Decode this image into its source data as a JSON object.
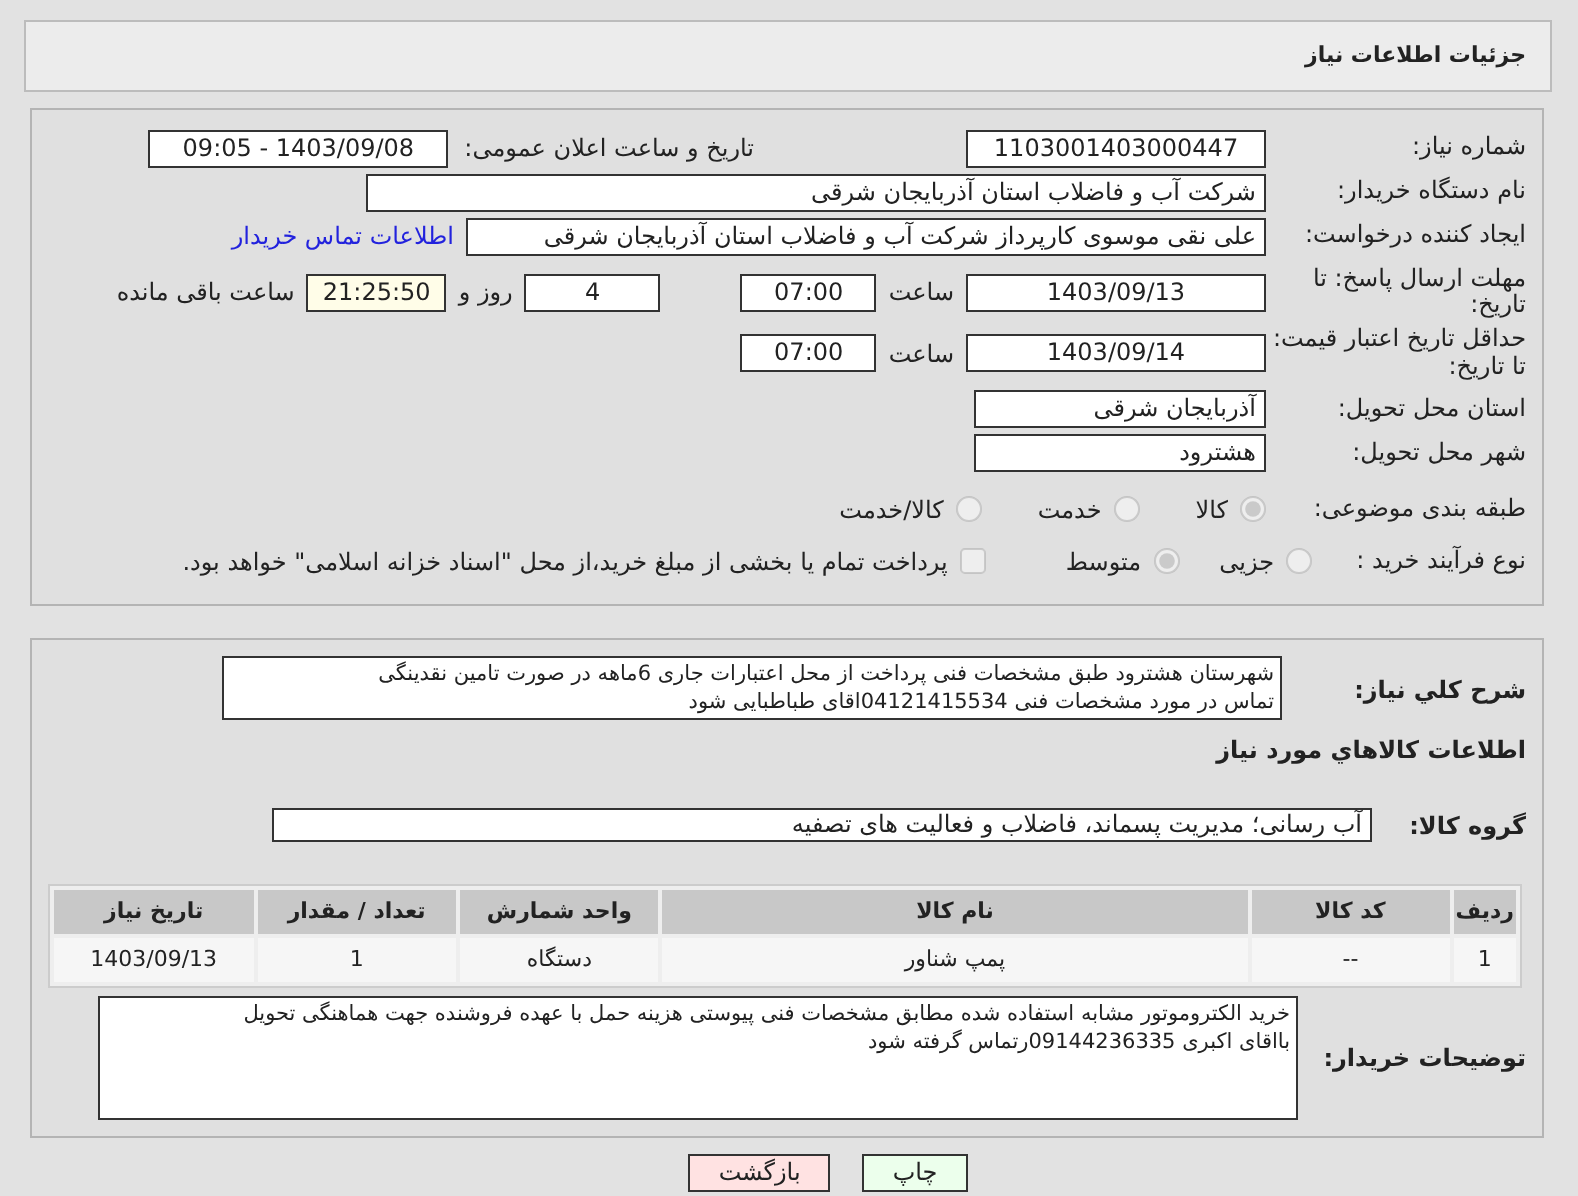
{
  "page_title": "جزئیات اطلاعات نیاز",
  "need_number": {
    "label": "شماره نیاز:",
    "value": "1103001403000447"
  },
  "announce": {
    "label": "تاریخ و ساعت اعلان عمومی:",
    "value": "1403/09/08 - 09:05"
  },
  "buyer": {
    "label": "نام دستگاه خریدار:",
    "value": "شرکت آب و فاضلاب استان آذربایجان شرقی"
  },
  "creator": {
    "label": "ایجاد کننده درخواست:",
    "value": "علی نقی موسوی کارپرداز شرکت آب و فاضلاب استان آذربایجان شرقی",
    "link": "اطلاعات تماس خریدار"
  },
  "reply_deadline": {
    "label": "مهلت ارسال پاسخ: تا تاریخ:",
    "date": "1403/09/13",
    "time_label": "ساعت",
    "time": "07:00",
    "days": "4",
    "days_label": "روز و",
    "remaining": "21:25:50",
    "remaining_label": "ساعت باقی مانده"
  },
  "price_validity": {
    "label": "حداقل تاریخ اعتبار قیمت: تا تاریخ:",
    "date": "1403/09/14",
    "time_label": "ساعت",
    "time": "07:00"
  },
  "province": {
    "label": "استان محل تحویل:",
    "value": "آذربایجان شرقی"
  },
  "city": {
    "label": "شهر محل تحویل:",
    "value": "هشترود"
  },
  "category": {
    "label": "طبقه بندی موضوعی:",
    "options": [
      {
        "label": "کالا",
        "selected": true
      },
      {
        "label": "خدمت",
        "selected": false
      },
      {
        "label": "کالا/خدمت",
        "selected": false
      }
    ]
  },
  "process": {
    "label": "نوع فرآیند خرید :",
    "options": [
      {
        "label": "جزیی",
        "selected": false
      },
      {
        "label": "متوسط",
        "selected": true
      }
    ],
    "checkbox": {
      "label": "پرداخت تمام یا بخشی از مبلغ خرید،از محل \"اسناد خزانه اسلامی\" خواهد بود.",
      "checked": false
    }
  },
  "description": {
    "label": "شرح کلي نياز:",
    "value": "شهرستان هشترود  طبق مشخصات فنی پرداخت از محل اعتبارات جاری  6ماهه در صورت تامین نقدینگی\nتماس در مورد مشخصات فنی 04121415534اقای  طباطبایی  شود"
  },
  "goods_heading": "اطلاعات کالاهاي مورد نياز",
  "goods_group": {
    "label": "گروه کالا:",
    "value": "آب رسانی؛ مدیریت پسماند، فاضلاب و فعالیت های تصفیه"
  },
  "table": {
    "columns": [
      "ردیف",
      "کد کالا",
      "نام کالا",
      "واحد شمارش",
      "تعداد / مقدار",
      "تاریخ نیاز"
    ],
    "rows": [
      [
        "1",
        "--",
        "پمپ شناور",
        "دستگاه",
        "1",
        "1403/09/13"
      ]
    ]
  },
  "buyer_notes": {
    "label": "توضیحات خریدار:",
    "value": "خرید الکتروموتور مشابه استفاده شده مطابق مشخصات فنی پیوستی  هزینه حمل با عهده فروشنده جهت هماهنگی تحویل\nبااقای اکبری 09144236335رتماس گرفته شود"
  },
  "buttons": [
    {
      "label": "چاپ",
      "kind": "print"
    },
    {
      "label": "بازگشت",
      "kind": "back"
    }
  ]
}
